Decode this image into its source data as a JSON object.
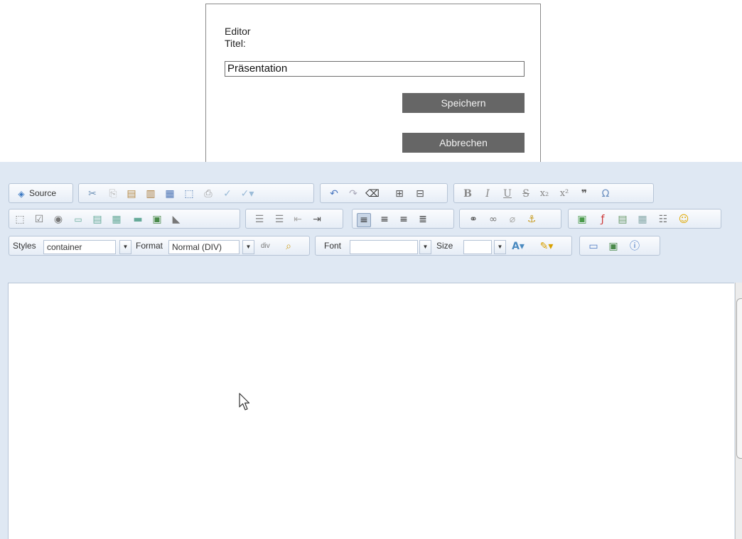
{
  "dialog": {
    "editor_label": "Editor",
    "title_label": "Titel:",
    "title_value": "Präsentation",
    "save_label": "Speichern",
    "cancel_label": "Abbrechen"
  },
  "toolbar": {
    "source_label": "Source",
    "styles_label": "Styles",
    "styles_value": "container",
    "format_label": "Format",
    "format_value": "Normal (DIV)",
    "font_label": "Font",
    "font_value": "",
    "size_label": "Size",
    "size_value": "",
    "div_label": "div"
  },
  "colors": {
    "dialog_button": "#666666",
    "editor_chrome": "#dfe8f3",
    "toolbar_border": "#b6c4d6"
  },
  "icons": {
    "row1": [
      "cut-icon",
      "copy-icon",
      "paste-icon",
      "paste-text-icon",
      "paste-word-icon",
      "select-all-icon",
      "print-icon",
      "spellcheck-icon",
      "spellcheck-dropdown-icon",
      "undo-icon",
      "redo-icon",
      "remove-format-icon",
      "find-icon",
      "replace-icon",
      "bold-icon",
      "italic-icon",
      "underline-icon",
      "strikethrough-icon",
      "subscript-icon",
      "superscript-icon",
      "blockquote-icon",
      "special-char-icon"
    ],
    "row2": [
      "form-icon",
      "checkbox-icon",
      "radio-icon",
      "textfield-icon",
      "textarea-icon",
      "select-field-icon",
      "button-icon",
      "image-button-icon",
      "hidden-field-icon",
      "numbered-list-icon",
      "bulleted-list-icon",
      "outdent-icon",
      "indent-icon",
      "align-left-icon",
      "align-center-icon",
      "align-right-icon",
      "justify-icon",
      "link-icon",
      "unlink-icon",
      "broken-link-icon",
      "anchor-icon",
      "image-icon",
      "flash-icon",
      "template-icon",
      "table-icon",
      "horizontal-rule-icon",
      "smiley-icon"
    ],
    "row3": [
      "div-container-icon",
      "find-zoom-icon",
      "text-color-icon",
      "bg-color-icon",
      "maximize-icon",
      "show-blocks-icon",
      "about-icon"
    ]
  }
}
